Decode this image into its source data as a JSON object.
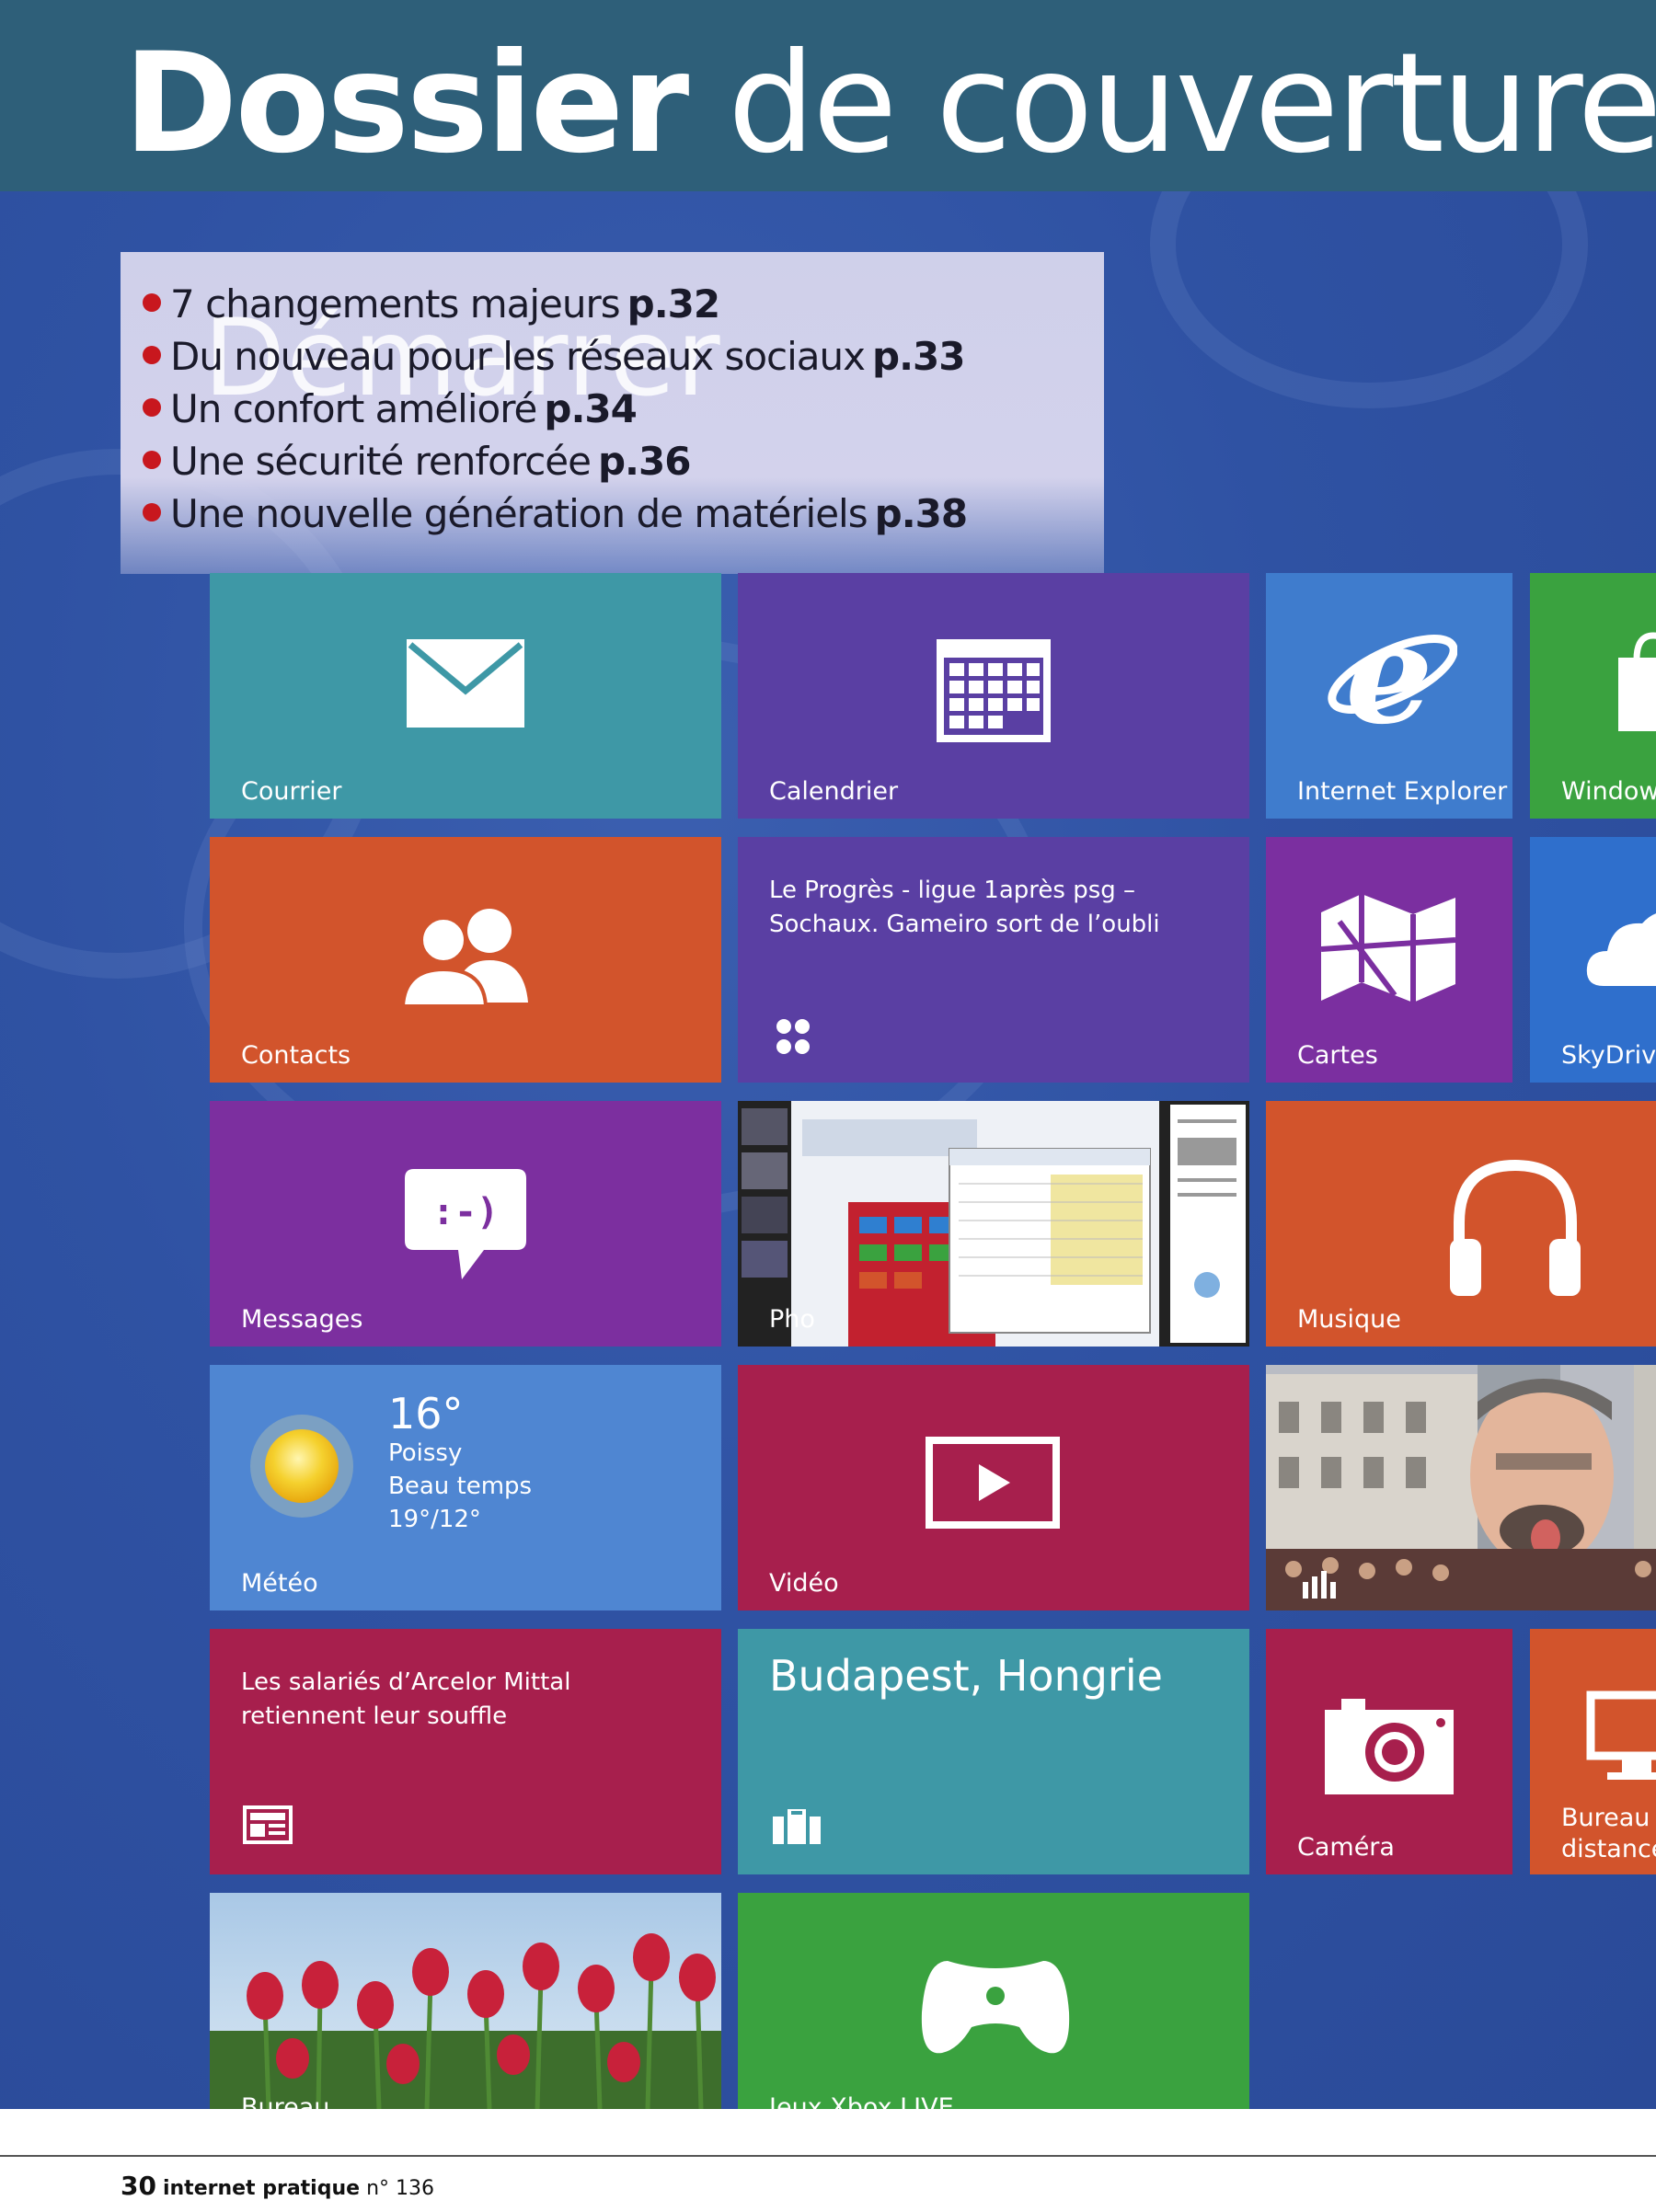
{
  "header": {
    "title_bold": "Dossier",
    "title_rest": "de couverture"
  },
  "summary": {
    "ghost_word": "Démarrer",
    "items": [
      {
        "text": "7 changements majeurs",
        "page": "p.32"
      },
      {
        "text": "Du nouveau pour les réseaux sociaux",
        "page": "p.33"
      },
      {
        "text": "Un confort amélioré",
        "page": "p.34"
      },
      {
        "text": "Une sécurité renforcée",
        "page": "p.36"
      },
      {
        "text": "Une nouvelle génération de matériels",
        "page": "p.38"
      }
    ]
  },
  "tiles": {
    "courrier": {
      "label": "Courrier",
      "color": "#3e98a6"
    },
    "calendrier": {
      "label": "Calendrier",
      "color": "#5a3fa3"
    },
    "ie": {
      "label": "Internet Explorer",
      "color": "#3f7ccd"
    },
    "store": {
      "label": "Windows",
      "color": "#3aa23f"
    },
    "contacts": {
      "label": "Contacts",
      "color": "#d2542c"
    },
    "news1": {
      "text": "Le Progrès - ligue 1après psg – Sochaux. Gameiro sort de l’oubli",
      "color": "#5a3fa3"
    },
    "cartes": {
      "label": "Cartes",
      "color": "#7b2fa0"
    },
    "skydrive": {
      "label": "SkyDrive",
      "color": "#2f6fcc"
    },
    "messages": {
      "label": "Messages",
      "color": "#7c2f9f"
    },
    "photos": {
      "label": "Pho"
    },
    "musique": {
      "label": "Musique",
      "color": "#d2542c"
    },
    "meteo": {
      "label": "Météo",
      "temp": "16°",
      "city": "Poissy",
      "condition": "Beau temps",
      "range": "19°/12°",
      "color": "#4f86d2"
    },
    "video": {
      "label": "Vidéo",
      "color": "#a71f4d"
    },
    "news2": {
      "text": "Les salariés d’Arcelor Mittal retiennent leur souffle",
      "color": "#a71f4d"
    },
    "voyage": {
      "title": "Budapest, Hongrie",
      "color": "#3e98a6"
    },
    "camera": {
      "label": "Caméra",
      "color": "#a71f4d"
    },
    "remote": {
      "label_line1": "Bureau à",
      "label_line2": "distance",
      "color": "#d2542c"
    },
    "bureau": {
      "label": "Bureau"
    },
    "xbox": {
      "label": "Jeux Xbox LIVE",
      "color": "#3aa23f"
    }
  },
  "footer": {
    "page_number": "30",
    "magazine": "internet pratique",
    "issue": "n° 136"
  }
}
